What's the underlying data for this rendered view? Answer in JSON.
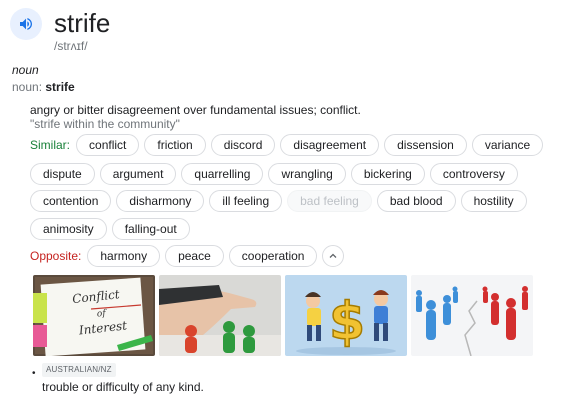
{
  "header": {
    "word": "strife",
    "phonetic": "/strʌɪf/",
    "speaker_icon": "volume-up-icon"
  },
  "sense1": {
    "pos_italic": "noun",
    "pos_label": "noun: ",
    "pos_word": "strife",
    "definition": "angry or bitter disagreement over fundamental issues; conflict.",
    "example": "\"strife within the community\""
  },
  "similar": {
    "label": "Similar:",
    "row1": [
      "conflict",
      "friction",
      "discord",
      "disagreement",
      "dissension",
      "variance"
    ],
    "row2": [
      "dispute",
      "argument",
      "quarrelling",
      "wrangling",
      "bickering",
      "controversy"
    ],
    "row3": [
      "contention",
      "disharmony",
      "ill feeling",
      "bad feeling",
      "bad blood",
      "hostility"
    ],
    "row4": [
      "animosity",
      "falling-out"
    ]
  },
  "opposite": {
    "label": "Opposite:",
    "items": [
      "harmony",
      "peace",
      "cooperation"
    ],
    "collapse_icon": "chevron-up-icon"
  },
  "images": {
    "img1_text": [
      "Conflict",
      "of",
      "Interest"
    ]
  },
  "sense2": {
    "region": "AUSTRALIAN/NZ",
    "definition": "trouble or difficulty of any kind."
  },
  "colors": {
    "similar_label": "#188038",
    "opposite_label": "#c5221f",
    "speaker_bg": "#e8f0fe",
    "speaker_icon": "#1a73e8"
  }
}
